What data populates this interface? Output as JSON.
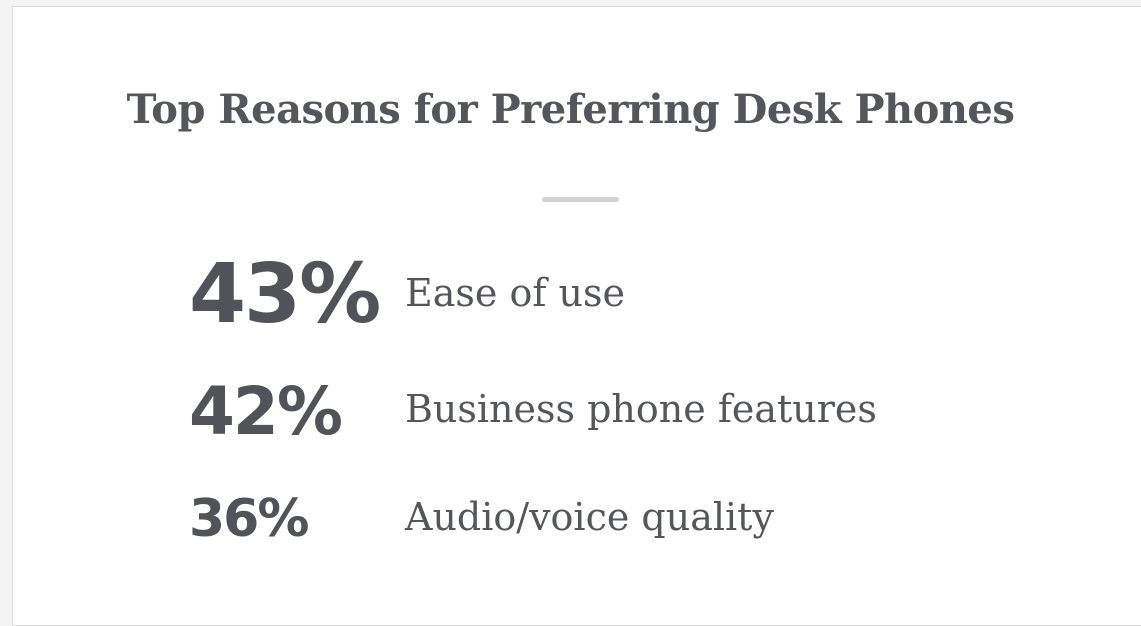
{
  "title": "Top Reasons for Preferring Desk Phones",
  "stats": [
    {
      "value": "43%",
      "label": "Ease of use"
    },
    {
      "value": "42%",
      "label": "Business phone features"
    },
    {
      "value": "36%",
      "label": "Audio/voice quality"
    }
  ],
  "chart_data": {
    "type": "table",
    "title": "Top Reasons for Preferring Desk Phones",
    "categories": [
      "Ease of use",
      "Business phone features",
      "Audio/voice quality"
    ],
    "values": [
      43,
      42,
      36
    ],
    "unit": "%"
  },
  "colors": {
    "text": "#54565b",
    "divider": "#d2d3d6",
    "background": "#ffffff"
  }
}
